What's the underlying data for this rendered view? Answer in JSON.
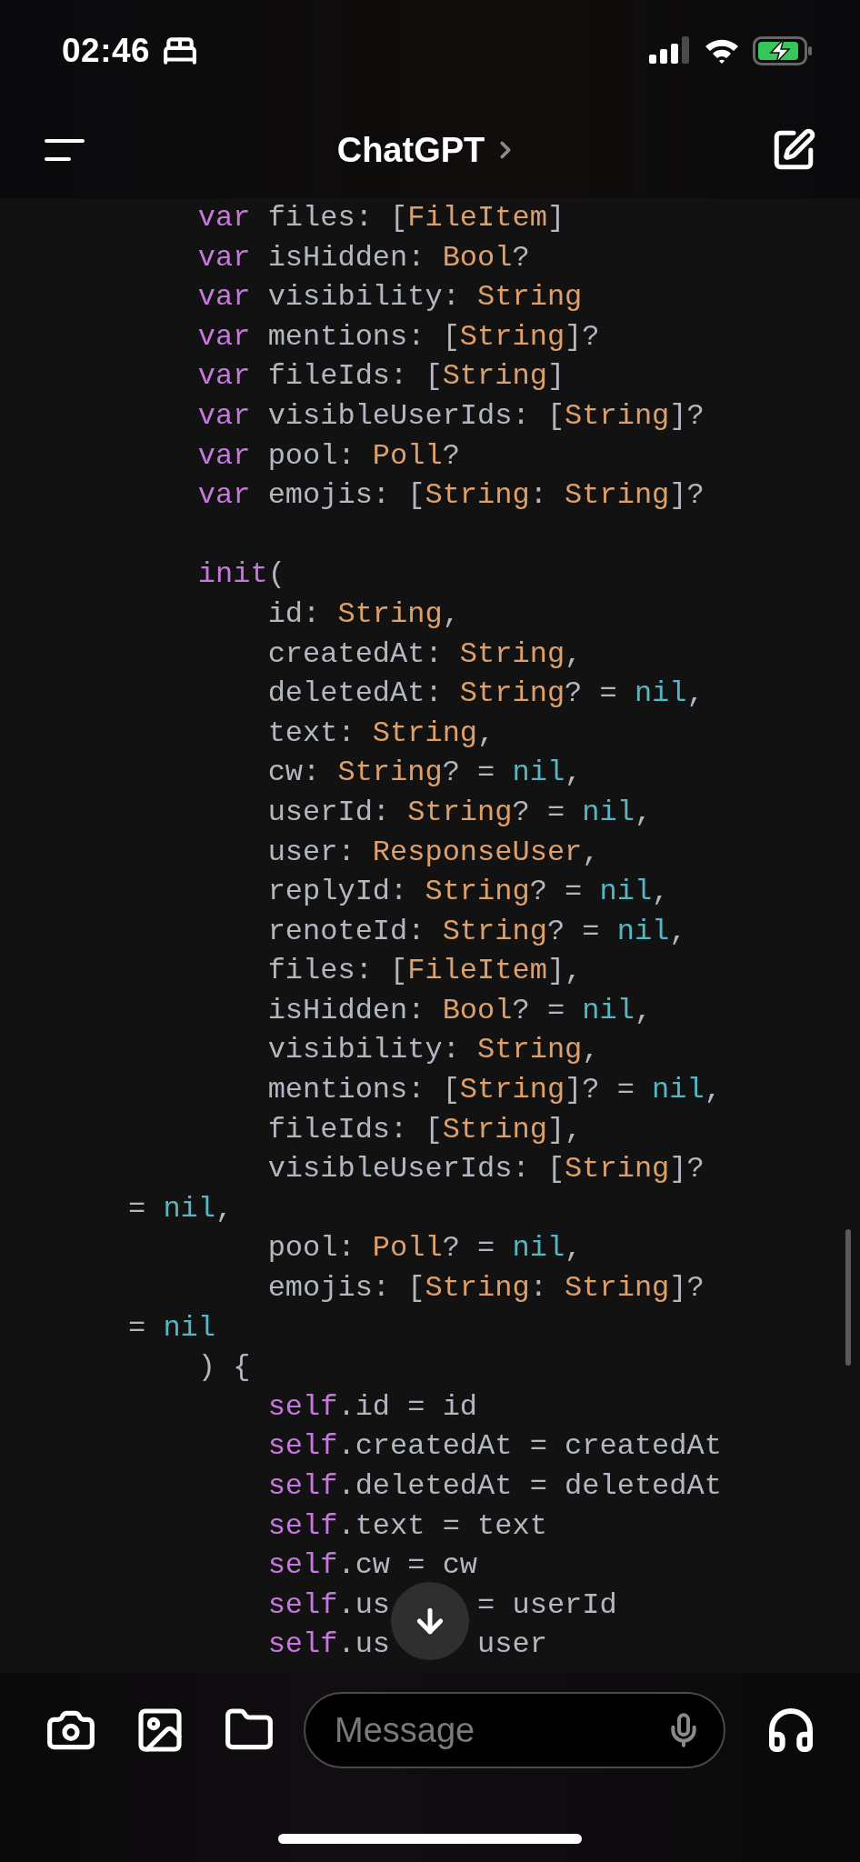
{
  "status_bar": {
    "time": "02:46"
  },
  "header": {
    "title": "ChatGPT"
  },
  "code": {
    "lines": [
      {
        "kind": "code",
        "tokens": [
          {
            "text": "    var",
            "kind": "keyword"
          },
          {
            "text": " files: [",
            "kind": "plain"
          },
          {
            "text": "FileItem",
            "kind": "type"
          },
          {
            "text": "]",
            "kind": "plain"
          }
        ]
      },
      {
        "kind": "code",
        "tokens": [
          {
            "text": "    var",
            "kind": "keyword"
          },
          {
            "text": " isHidden: ",
            "kind": "plain"
          },
          {
            "text": "Bool",
            "kind": "type"
          },
          {
            "text": "?",
            "kind": "plain"
          }
        ]
      },
      {
        "kind": "code",
        "tokens": [
          {
            "text": "    var",
            "kind": "keyword"
          },
          {
            "text": " visibility: ",
            "kind": "plain"
          },
          {
            "text": "String",
            "kind": "type"
          }
        ]
      },
      {
        "kind": "code",
        "tokens": [
          {
            "text": "    var",
            "kind": "keyword"
          },
          {
            "text": " mentions: [",
            "kind": "plain"
          },
          {
            "text": "String",
            "kind": "type"
          },
          {
            "text": "]?",
            "kind": "plain"
          }
        ]
      },
      {
        "kind": "code",
        "tokens": [
          {
            "text": "    var",
            "kind": "keyword"
          },
          {
            "text": " fileIds: [",
            "kind": "plain"
          },
          {
            "text": "String",
            "kind": "type"
          },
          {
            "text": "]",
            "kind": "plain"
          }
        ]
      },
      {
        "kind": "code",
        "tokens": [
          {
            "text": "    var",
            "kind": "keyword"
          },
          {
            "text": " visibleUserIds: [",
            "kind": "plain"
          },
          {
            "text": "String",
            "kind": "type"
          },
          {
            "text": "]?",
            "kind": "plain"
          }
        ]
      },
      {
        "kind": "code",
        "tokens": [
          {
            "text": "    var",
            "kind": "keyword"
          },
          {
            "text": " pool: ",
            "kind": "plain"
          },
          {
            "text": "Poll",
            "kind": "type"
          },
          {
            "text": "?",
            "kind": "plain"
          }
        ]
      },
      {
        "kind": "code",
        "tokens": [
          {
            "text": "    var",
            "kind": "keyword"
          },
          {
            "text": " emojis: [",
            "kind": "plain"
          },
          {
            "text": "String",
            "kind": "type"
          },
          {
            "text": ": ",
            "kind": "plain"
          },
          {
            "text": "String",
            "kind": "type"
          },
          {
            "text": "]?",
            "kind": "plain"
          }
        ]
      },
      {
        "kind": "blank"
      },
      {
        "kind": "code",
        "tokens": [
          {
            "text": "    init",
            "kind": "keyword"
          },
          {
            "text": "(",
            "kind": "plain"
          }
        ]
      },
      {
        "kind": "code",
        "tokens": [
          {
            "text": "        id: ",
            "kind": "plain"
          },
          {
            "text": "String",
            "kind": "type"
          },
          {
            "text": ",",
            "kind": "plain"
          }
        ]
      },
      {
        "kind": "code",
        "tokens": [
          {
            "text": "        createdAt: ",
            "kind": "plain"
          },
          {
            "text": "String",
            "kind": "type"
          },
          {
            "text": ",",
            "kind": "plain"
          }
        ]
      },
      {
        "kind": "code",
        "tokens": [
          {
            "text": "        deletedAt: ",
            "kind": "plain"
          },
          {
            "text": "String",
            "kind": "type"
          },
          {
            "text": "? = ",
            "kind": "plain"
          },
          {
            "text": "nil",
            "kind": "literal"
          },
          {
            "text": ",",
            "kind": "plain"
          }
        ]
      },
      {
        "kind": "code",
        "tokens": [
          {
            "text": "        text: ",
            "kind": "plain"
          },
          {
            "text": "String",
            "kind": "type"
          },
          {
            "text": ",",
            "kind": "plain"
          }
        ]
      },
      {
        "kind": "code",
        "tokens": [
          {
            "text": "        cw: ",
            "kind": "plain"
          },
          {
            "text": "String",
            "kind": "type"
          },
          {
            "text": "? = ",
            "kind": "plain"
          },
          {
            "text": "nil",
            "kind": "literal"
          },
          {
            "text": ",",
            "kind": "plain"
          }
        ]
      },
      {
        "kind": "code",
        "tokens": [
          {
            "text": "        userId: ",
            "kind": "plain"
          },
          {
            "text": "String",
            "kind": "type"
          },
          {
            "text": "? = ",
            "kind": "plain"
          },
          {
            "text": "nil",
            "kind": "literal"
          },
          {
            "text": ",",
            "kind": "plain"
          }
        ]
      },
      {
        "kind": "code",
        "tokens": [
          {
            "text": "        user: ",
            "kind": "plain"
          },
          {
            "text": "ResponseUser",
            "kind": "type"
          },
          {
            "text": ",",
            "kind": "plain"
          }
        ]
      },
      {
        "kind": "code",
        "tokens": [
          {
            "text": "        replyId: ",
            "kind": "plain"
          },
          {
            "text": "String",
            "kind": "type"
          },
          {
            "text": "? = ",
            "kind": "plain"
          },
          {
            "text": "nil",
            "kind": "literal"
          },
          {
            "text": ",",
            "kind": "plain"
          }
        ]
      },
      {
        "kind": "code",
        "tokens": [
          {
            "text": "        renoteId: ",
            "kind": "plain"
          },
          {
            "text": "String",
            "kind": "type"
          },
          {
            "text": "? = ",
            "kind": "plain"
          },
          {
            "text": "nil",
            "kind": "literal"
          },
          {
            "text": ",",
            "kind": "plain"
          }
        ]
      },
      {
        "kind": "code",
        "tokens": [
          {
            "text": "        files: [",
            "kind": "plain"
          },
          {
            "text": "FileItem",
            "kind": "type"
          },
          {
            "text": "],",
            "kind": "plain"
          }
        ]
      },
      {
        "kind": "code",
        "tokens": [
          {
            "text": "        isHidden: ",
            "kind": "plain"
          },
          {
            "text": "Bool",
            "kind": "type"
          },
          {
            "text": "? = ",
            "kind": "plain"
          },
          {
            "text": "nil",
            "kind": "literal"
          },
          {
            "text": ",",
            "kind": "plain"
          }
        ]
      },
      {
        "kind": "code",
        "tokens": [
          {
            "text": "        visibility: ",
            "kind": "plain"
          },
          {
            "text": "String",
            "kind": "type"
          },
          {
            "text": ",",
            "kind": "plain"
          }
        ]
      },
      {
        "kind": "code",
        "tokens": [
          {
            "text": "        mentions: [",
            "kind": "plain"
          },
          {
            "text": "String",
            "kind": "type"
          },
          {
            "text": "]? = ",
            "kind": "plain"
          },
          {
            "text": "nil",
            "kind": "literal"
          },
          {
            "text": ",",
            "kind": "plain"
          }
        ]
      },
      {
        "kind": "code",
        "tokens": [
          {
            "text": "        fileIds: [",
            "kind": "plain"
          },
          {
            "text": "String",
            "kind": "type"
          },
          {
            "text": "],",
            "kind": "plain"
          }
        ]
      },
      {
        "kind": "code",
        "tokens": [
          {
            "text": "        visibleUserIds: [",
            "kind": "plain"
          },
          {
            "text": "String",
            "kind": "type"
          },
          {
            "text": "]?",
            "kind": "plain"
          }
        ]
      },
      {
        "kind": "code",
        "tokens": [
          {
            "text": "= ",
            "kind": "plain"
          },
          {
            "text": "nil",
            "kind": "literal"
          },
          {
            "text": ",",
            "kind": "plain"
          }
        ]
      },
      {
        "kind": "code",
        "tokens": [
          {
            "text": "        pool: ",
            "kind": "plain"
          },
          {
            "text": "Poll",
            "kind": "type"
          },
          {
            "text": "? = ",
            "kind": "plain"
          },
          {
            "text": "nil",
            "kind": "literal"
          },
          {
            "text": ",",
            "kind": "plain"
          }
        ]
      },
      {
        "kind": "code",
        "tokens": [
          {
            "text": "        emojis: [",
            "kind": "plain"
          },
          {
            "text": "String",
            "kind": "type"
          },
          {
            "text": ": ",
            "kind": "plain"
          },
          {
            "text": "String",
            "kind": "type"
          },
          {
            "text": "]?",
            "kind": "plain"
          }
        ]
      },
      {
        "kind": "code",
        "tokens": [
          {
            "text": "= ",
            "kind": "plain"
          },
          {
            "text": "nil",
            "kind": "literal"
          }
        ]
      },
      {
        "kind": "code",
        "tokens": [
          {
            "text": "    ) {",
            "kind": "plain"
          }
        ]
      },
      {
        "kind": "code",
        "tokens": [
          {
            "text": "        self",
            "kind": "keyword"
          },
          {
            "text": ".id = id",
            "kind": "plain"
          }
        ]
      },
      {
        "kind": "code",
        "tokens": [
          {
            "text": "        self",
            "kind": "keyword"
          },
          {
            "text": ".createdAt = createdAt",
            "kind": "plain"
          }
        ]
      },
      {
        "kind": "code",
        "tokens": [
          {
            "text": "        self",
            "kind": "keyword"
          },
          {
            "text": ".deletedAt = deletedAt",
            "kind": "plain"
          }
        ]
      },
      {
        "kind": "code",
        "tokens": [
          {
            "text": "        self",
            "kind": "keyword"
          },
          {
            "text": ".text = text",
            "kind": "plain"
          }
        ]
      },
      {
        "kind": "code",
        "tokens": [
          {
            "text": "        self",
            "kind": "keyword"
          },
          {
            "text": ".cw = cw",
            "kind": "plain"
          }
        ]
      },
      {
        "kind": "split",
        "segments": [
          {
            "tokens": [
              {
                "text": "        self",
                "kind": "keyword"
              },
              {
                "text": ".us",
                "kind": "plain"
              }
            ]
          },
          {
            "tokens": [
              {
                "text": "= userId",
                "kind": "plain"
              }
            ]
          }
        ]
      },
      {
        "kind": "split",
        "segments": [
          {
            "tokens": [
              {
                "text": "        self",
                "kind": "keyword"
              },
              {
                "text": ".us",
                "kind": "plain"
              }
            ]
          },
          {
            "tokens": [
              {
                "text": "user",
                "kind": "plain"
              }
            ]
          }
        ]
      }
    ]
  },
  "composer": {
    "placeholder": "Message"
  }
}
